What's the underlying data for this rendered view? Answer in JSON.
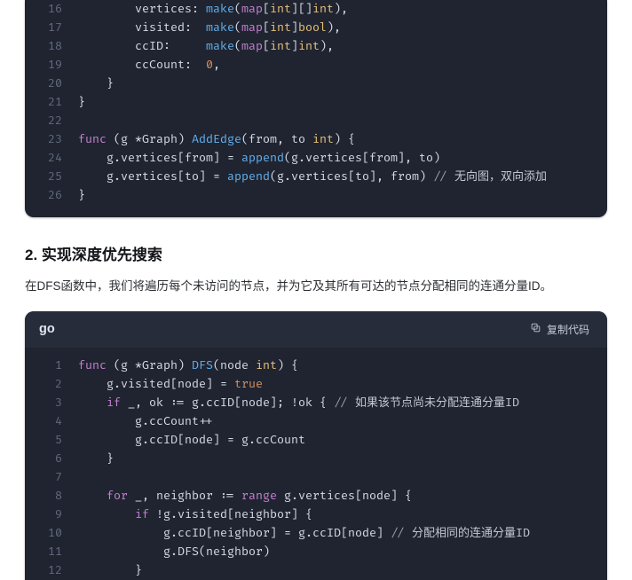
{
  "block1": {
    "line_start": 16,
    "lines": [
      [
        [
          "        vertices: ",
          null
        ],
        [
          "make",
          "fn"
        ],
        [
          "(",
          null
        ],
        [
          "map",
          "kw"
        ],
        [
          "[",
          null
        ],
        [
          "int",
          "ty"
        ],
        [
          "][]",
          null
        ],
        [
          "int",
          "ty"
        ],
        [
          "),",
          null
        ]
      ],
      [
        [
          "        visited:  ",
          null
        ],
        [
          "make",
          "fn"
        ],
        [
          "(",
          null
        ],
        [
          "map",
          "kw"
        ],
        [
          "[",
          null
        ],
        [
          "int",
          "ty"
        ],
        [
          "]",
          null
        ],
        [
          "bool",
          "ty"
        ],
        [
          "),",
          null
        ]
      ],
      [
        [
          "        ccID:     ",
          null
        ],
        [
          "make",
          "fn"
        ],
        [
          "(",
          null
        ],
        [
          "map",
          "kw"
        ],
        [
          "[",
          null
        ],
        [
          "int",
          "ty"
        ],
        [
          "]",
          null
        ],
        [
          "int",
          "ty"
        ],
        [
          "),",
          null
        ]
      ],
      [
        [
          "        ccCount:  ",
          null
        ],
        [
          "0",
          "nm"
        ],
        [
          ",",
          null
        ]
      ],
      [
        [
          "    }",
          null
        ]
      ],
      [
        [
          "}",
          null
        ]
      ],
      [
        [
          "",
          null
        ]
      ],
      [
        [
          "func",
          "kw"
        ],
        [
          " (g *Graph) ",
          null
        ],
        [
          "AddEdge",
          "fn"
        ],
        [
          "(from, to ",
          null
        ],
        [
          "int",
          "ty"
        ],
        [
          ") {",
          null
        ]
      ],
      [
        [
          "    g.vertices[from] = ",
          null
        ],
        [
          "append",
          "fn"
        ],
        [
          "(g.vertices[from], to)",
          null
        ]
      ],
      [
        [
          "    g.vertices[to] = ",
          null
        ],
        [
          "append",
          "fn"
        ],
        [
          "(g.vertices[to], from) ",
          null
        ],
        [
          "// ",
          "cm"
        ],
        [
          "无向图，双向添加",
          "cm-cjk"
        ]
      ],
      [
        [
          "}",
          null
        ]
      ]
    ]
  },
  "section_heading": "2. 实现深度优先搜索",
  "section_para": "在DFS函数中，我们将遍历每个未访问的节点，并为它及其所有可达的节点分配相同的连通分量ID。",
  "block2": {
    "lang": "go",
    "copy_label": "复制代码",
    "line_start": 1,
    "lines": [
      [
        [
          "func",
          "kw"
        ],
        [
          " (g *Graph) ",
          null
        ],
        [
          "DFS",
          "fn"
        ],
        [
          "(node ",
          null
        ],
        [
          "int",
          "ty"
        ],
        [
          ") {",
          null
        ]
      ],
      [
        [
          "    g.visited[node] = ",
          null
        ],
        [
          "true",
          "nm"
        ]
      ],
      [
        [
          "    ",
          null
        ],
        [
          "if",
          "kw"
        ],
        [
          " _, ok := g.ccID[node]; !ok { ",
          null
        ],
        [
          "// ",
          "cm"
        ],
        [
          "如果该节点尚未分配连通分量ID",
          "cm-cjk"
        ]
      ],
      [
        [
          "        g.ccCount++",
          null
        ]
      ],
      [
        [
          "        g.ccID[node] = g.ccCount",
          null
        ]
      ],
      [
        [
          "    }",
          null
        ]
      ],
      [
        [
          "",
          null
        ]
      ],
      [
        [
          "    ",
          null
        ],
        [
          "for",
          "kw"
        ],
        [
          " _, neighbor := ",
          null
        ],
        [
          "range",
          "kw"
        ],
        [
          " g.vertices[node] {",
          null
        ]
      ],
      [
        [
          "        ",
          null
        ],
        [
          "if",
          "kw"
        ],
        [
          " !g.visited[neighbor] {",
          null
        ]
      ],
      [
        [
          "            g.ccID[neighbor] = g.ccID[node] ",
          null
        ],
        [
          "// ",
          "cm"
        ],
        [
          "分配相同的连通分量ID",
          "cm-cjk"
        ]
      ],
      [
        [
          "            g.DFS(neighbor)",
          null
        ]
      ],
      [
        [
          "        }",
          null
        ]
      ]
    ]
  },
  "chart_data": null
}
